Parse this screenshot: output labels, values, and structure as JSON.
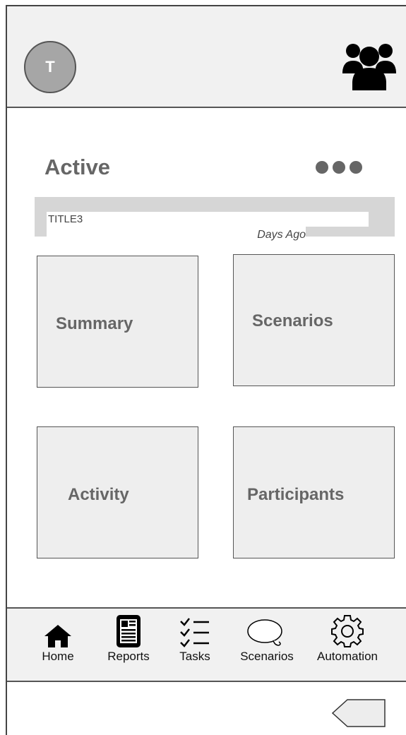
{
  "header": {
    "avatar_initial": "T"
  },
  "section": {
    "title": "Active"
  },
  "item": {
    "title": "TITLE3",
    "subtitle": "Days Ago"
  },
  "tiles": [
    {
      "label": "Summary"
    },
    {
      "label": "Scenarios"
    },
    {
      "label": "Activity"
    },
    {
      "label": "Participants"
    }
  ],
  "tabs": [
    {
      "label": "Home",
      "icon": "home-icon"
    },
    {
      "label": "Reports",
      "icon": "reports-icon"
    },
    {
      "label": "Tasks",
      "icon": "tasks-icon"
    },
    {
      "label": "Scenarios",
      "icon": "speech-bubble-icon"
    },
    {
      "label": "Automation",
      "icon": "gear-icon"
    }
  ],
  "colors": {
    "header_bg": "#f1f1f1",
    "tile_bg": "#eeeeee",
    "strip_bg": "#d6d6d6",
    "text_gray": "#666666"
  }
}
